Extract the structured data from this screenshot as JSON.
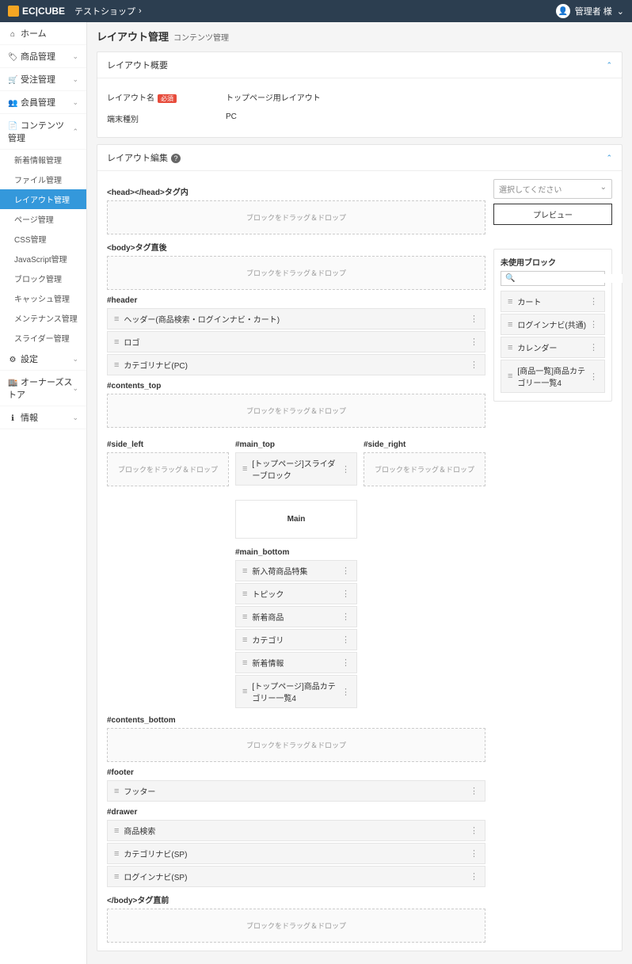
{
  "topbar": {
    "logo": "EC|CUBE",
    "shop": "テストショップ",
    "user": "管理者 様"
  },
  "sidebar": {
    "home": "ホーム",
    "product": "商品管理",
    "order": "受注管理",
    "member": "会員管理",
    "contents": "コンテンツ管理",
    "subs": {
      "news": "新着情報管理",
      "file": "ファイル管理",
      "layout": "レイアウト管理",
      "page": "ページ管理",
      "css": "CSS管理",
      "js": "JavaScript管理",
      "block": "ブロック管理",
      "cache": "キャッシュ管理",
      "maint": "メンテナンス管理",
      "slider": "スライダー管理"
    },
    "setting": "設定",
    "owners": "オーナーズストア",
    "info": "情報"
  },
  "page": {
    "title": "レイアウト管理",
    "sub": "コンテンツ管理"
  },
  "overview": {
    "title": "レイアウト概要",
    "name_label": "レイアウト名",
    "required": "必須",
    "name_value": "トップページ用レイアウト",
    "device_label": "端末種別",
    "device_value": "PC"
  },
  "edit": {
    "title": "レイアウト編集",
    "drag_text": "ブロックをドラッグ＆ドロップ",
    "head": "<head></head>タグ内",
    "body_after": "<body>タグ直後",
    "header": "#header",
    "contents_top": "#contents_top",
    "side_left": "#side_left",
    "main_top": "#main_top",
    "side_right": "#side_right",
    "main_label": "Main",
    "main_bottom": "#main_bottom",
    "contents_bottom": "#contents_bottom",
    "footer": "#footer",
    "drawer": "#drawer",
    "body_before_close": "</body>タグ直前"
  },
  "blocks": {
    "header": [
      "ヘッダー(商品検索・ログインナビ・カート)",
      "ロゴ",
      "カテゴリナビ(PC)"
    ],
    "main_top": [
      "[トップページ]スライダーブロック"
    ],
    "main_bottom": [
      "新入荷商品特集",
      "トピック",
      "新着商品",
      "カテゴリ",
      "新着情報",
      "[トップページ]商品カテゴリー一覧4"
    ],
    "footer": [
      "フッター"
    ],
    "drawer": [
      "商品検索",
      "カテゴリナビ(SP)",
      "ログインナビ(SP)"
    ]
  },
  "side": {
    "select_placeholder": "選択してください",
    "preview": "プレビュー",
    "unused_title": "未使用ブロック",
    "search_placeholder": "",
    "unused": [
      "カート",
      "ログインナビ(共通)",
      "カレンダー",
      "[商品一覧]商品カテゴリー一覧4"
    ]
  }
}
